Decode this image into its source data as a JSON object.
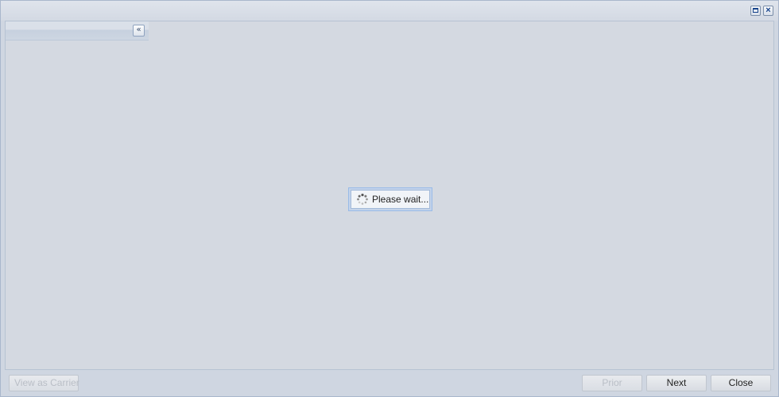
{
  "window": {
    "maximize_icon": "maximize-icon",
    "close_icon": "close-icon"
  },
  "side_panel": {
    "collapse_icon": "double-chevron-left-icon",
    "collapse_glyph": "«"
  },
  "loading": {
    "message": "Please wait...",
    "icon": "spinner-icon"
  },
  "footer": {
    "view_as_carrier": "View as Carrier",
    "prior": "Prior",
    "next": "Next",
    "close": "Close"
  },
  "colors": {
    "window_bg": "#cfd6e1",
    "body_bg": "#d4d9e1",
    "accent_border": "#99bbe8",
    "disabled_text": "#b9bec6"
  }
}
